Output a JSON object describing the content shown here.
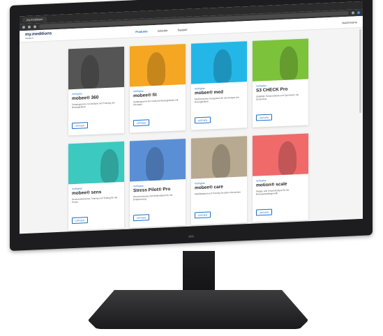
{
  "browser": {
    "tab_title": "my.meditions"
  },
  "app": {
    "logo": "my.meditions",
    "logo_sub": "medtech",
    "nav": [
      {
        "label": "Produkte",
        "active": true
      },
      {
        "label": "Zubehör",
        "active": false
      },
      {
        "label": "Support",
        "active": false
      }
    ],
    "user": "Nutzername"
  },
  "cards": [
    {
      "label": "Verfügbar",
      "title": "mobee® 360",
      "desc": "Testprogramm zur Analyse und Training der Beweglichkeit",
      "button": "OFFNEN",
      "color": "#555555"
    },
    {
      "label": "Verfügbar",
      "title": "mobee® fit",
      "desc": "Testprogramm für Kraft und Beweglichkeit mit Übungen",
      "button": "OFFNEN",
      "color": "#f5a623"
    },
    {
      "label": "Verfügbar",
      "title": "mobee® med",
      "desc": "Medizinisches Testsystem für die Analyse der Beweglichkeit",
      "button": "OFFNEN",
      "color": "#25b6e8"
    },
    {
      "label": "Verfügbar",
      "title": "S3 CHECK Pro",
      "desc": "Stabilität, Sensomotorik und Symmetrie mit Sensortest",
      "button": "OFFNEN",
      "color": "#7cc23b"
    },
    {
      "label": "Verfügbar",
      "title": "mobee® sens",
      "desc": "Sensomotorisches Training und Testing für die Praxis",
      "button": "OFFNEN",
      "color": "#3cc9c0"
    },
    {
      "label": "Verfügbar",
      "title": "Stress Pilot® Pro",
      "desc": "Stressmessung und Biofeedback für die Entspannung",
      "button": "OFFNEN",
      "color": "#5a8fd6"
    },
    {
      "label": "Verfügbar",
      "title": "mobee® care",
      "desc": "Mobilitätstest und Training für ältere Menschen",
      "button": "OFFNEN",
      "color": "#b8aa90"
    },
    {
      "label": "Verfügbar",
      "title": "motion® scale",
      "desc": "Waage und Körperanalyse für die Bewegungsdiagnostik",
      "button": "OFFNEN",
      "color": "#f06a6a"
    }
  ]
}
